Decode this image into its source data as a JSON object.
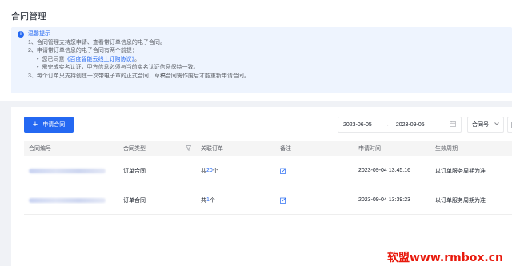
{
  "page": {
    "title": "合同管理"
  },
  "notice": {
    "heading": "温馨提示",
    "line1": "1、合同管理支持您申请、查看带订单信息的电子合同。",
    "line2": "2、申请带订单信息的电子合同有两个前提：",
    "line2a_prefix": "您已同意",
    "line2a_link": "《百度智能云线上订购协议》",
    "line2a_suffix": "。",
    "line2b": "需完成实名认证，甲方信息必须与当前实名认证信息保持一致。",
    "line3": "3、每个订单只支持创建一次带电子章的正式合同，草稿合同需作废后才能重新申请合同。"
  },
  "toolbar": {
    "apply_label": "申请合同",
    "date_start": "2023-06-05",
    "date_end": "2023-09-05",
    "range_arrow": "→",
    "select_value": "合同号"
  },
  "table": {
    "columns": [
      "合同编号",
      "合同类型",
      "关联订单",
      "备注",
      "申请时间",
      "生效周期"
    ],
    "rows": [
      {
        "type": "订单合同",
        "orders_prefix": "共",
        "orders_count": "20",
        "orders_suffix": "个",
        "time": "2023-09-04 13:45:16",
        "period": "以订单服务周期为准"
      },
      {
        "type": "订单合同",
        "orders_prefix": "共",
        "orders_count": "1",
        "orders_suffix": "个",
        "time": "2023-09-04 13:39:23",
        "period": "以订单服务周期为准"
      }
    ]
  },
  "watermark": "软盟www.rmbox.cn",
  "colors": {
    "accent": "#2468f2",
    "notice_bg": "#eef4fe",
    "watermark": "#e8190c"
  }
}
